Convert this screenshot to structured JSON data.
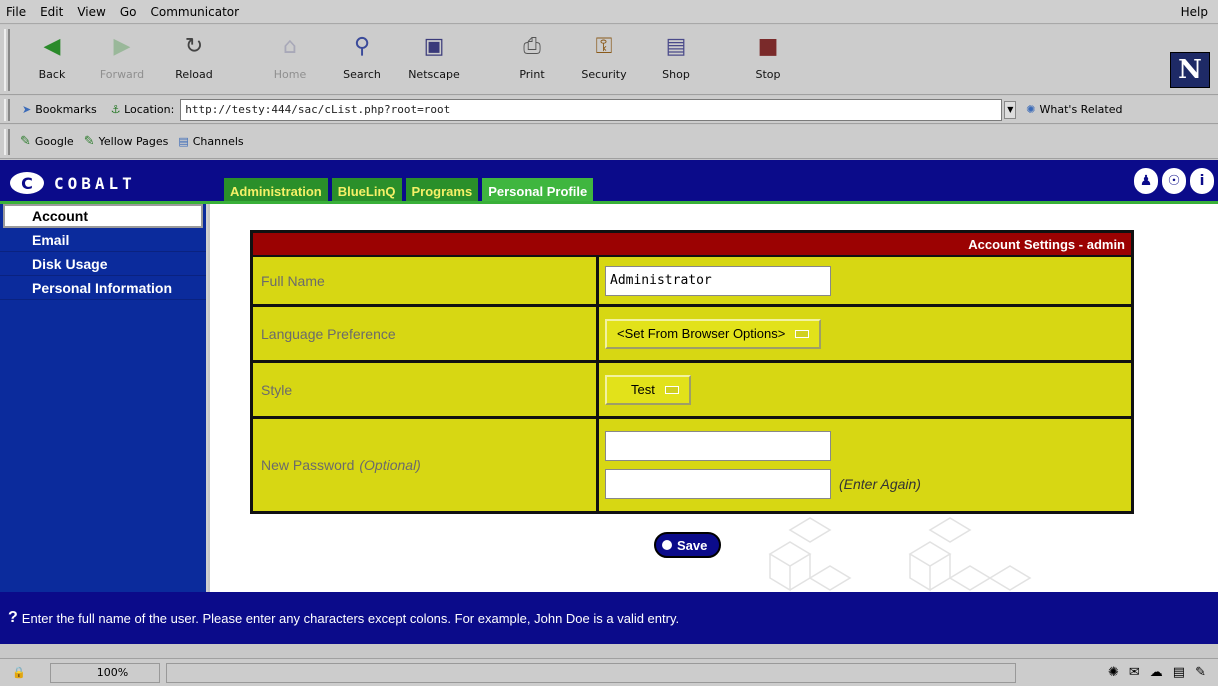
{
  "menubar": {
    "items": [
      "File",
      "Edit",
      "View",
      "Go",
      "Communicator"
    ],
    "help": "Help"
  },
  "toolbar": {
    "back": "Back",
    "forward": "Forward",
    "reload": "Reload",
    "home": "Home",
    "search": "Search",
    "netscape": "Netscape",
    "print": "Print",
    "security": "Security",
    "shop": "Shop",
    "stop": "Stop"
  },
  "location": {
    "bookmarks": "Bookmarks",
    "label": "Location:",
    "url": "http://testy:444/sac/cList.php?root=root",
    "related": "What's Related"
  },
  "personal_toolbar": {
    "items": [
      "Google",
      "Yellow Pages",
      "Channels"
    ]
  },
  "header": {
    "logo_text": "COBALT",
    "tabs": [
      "Administration",
      "BlueLinQ",
      "Programs",
      "Personal Profile"
    ],
    "active_tab": "Personal Profile"
  },
  "sidebar": {
    "items": [
      "Account",
      "Email",
      "Disk Usage",
      "Personal Information"
    ],
    "active": "Account"
  },
  "form": {
    "title": "Account Settings - admin",
    "full_name_label": "Full Name",
    "full_name_value": "Administrator",
    "language_label": "Language Preference",
    "language_value": "<Set From Browser Options>",
    "style_label": "Style",
    "style_value": "Test",
    "password_label": "New Password",
    "password_optional": "(Optional)",
    "enter_again": "(Enter Again)",
    "save": "Save"
  },
  "help_text": "Enter the full name of the user. Please enter any characters except colons. For example, John Doe is a valid entry.",
  "status": {
    "progress": "100%"
  }
}
